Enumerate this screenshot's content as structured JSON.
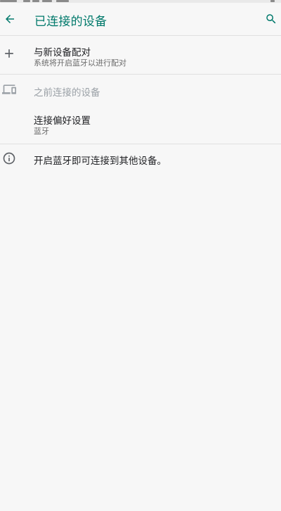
{
  "header": {
    "title": "已连接的设备"
  },
  "rows": {
    "pair_new": {
      "title": "与新设备配对",
      "subtitle": "系统将开启蓝牙以进行配对"
    },
    "previous": {
      "title": "之前连接的设备"
    },
    "preferences": {
      "title": "连接偏好设置",
      "subtitle": "蓝牙"
    }
  },
  "info": {
    "text": "开启蓝牙即可连接到其他设备。"
  },
  "colors": {
    "accent": "#00796b",
    "background": "#f7f7f7",
    "divider": "#e0e0e0"
  },
  "icons": [
    "back-arrow-icon",
    "search-icon",
    "plus-icon",
    "devices-icon",
    "info-icon"
  ]
}
